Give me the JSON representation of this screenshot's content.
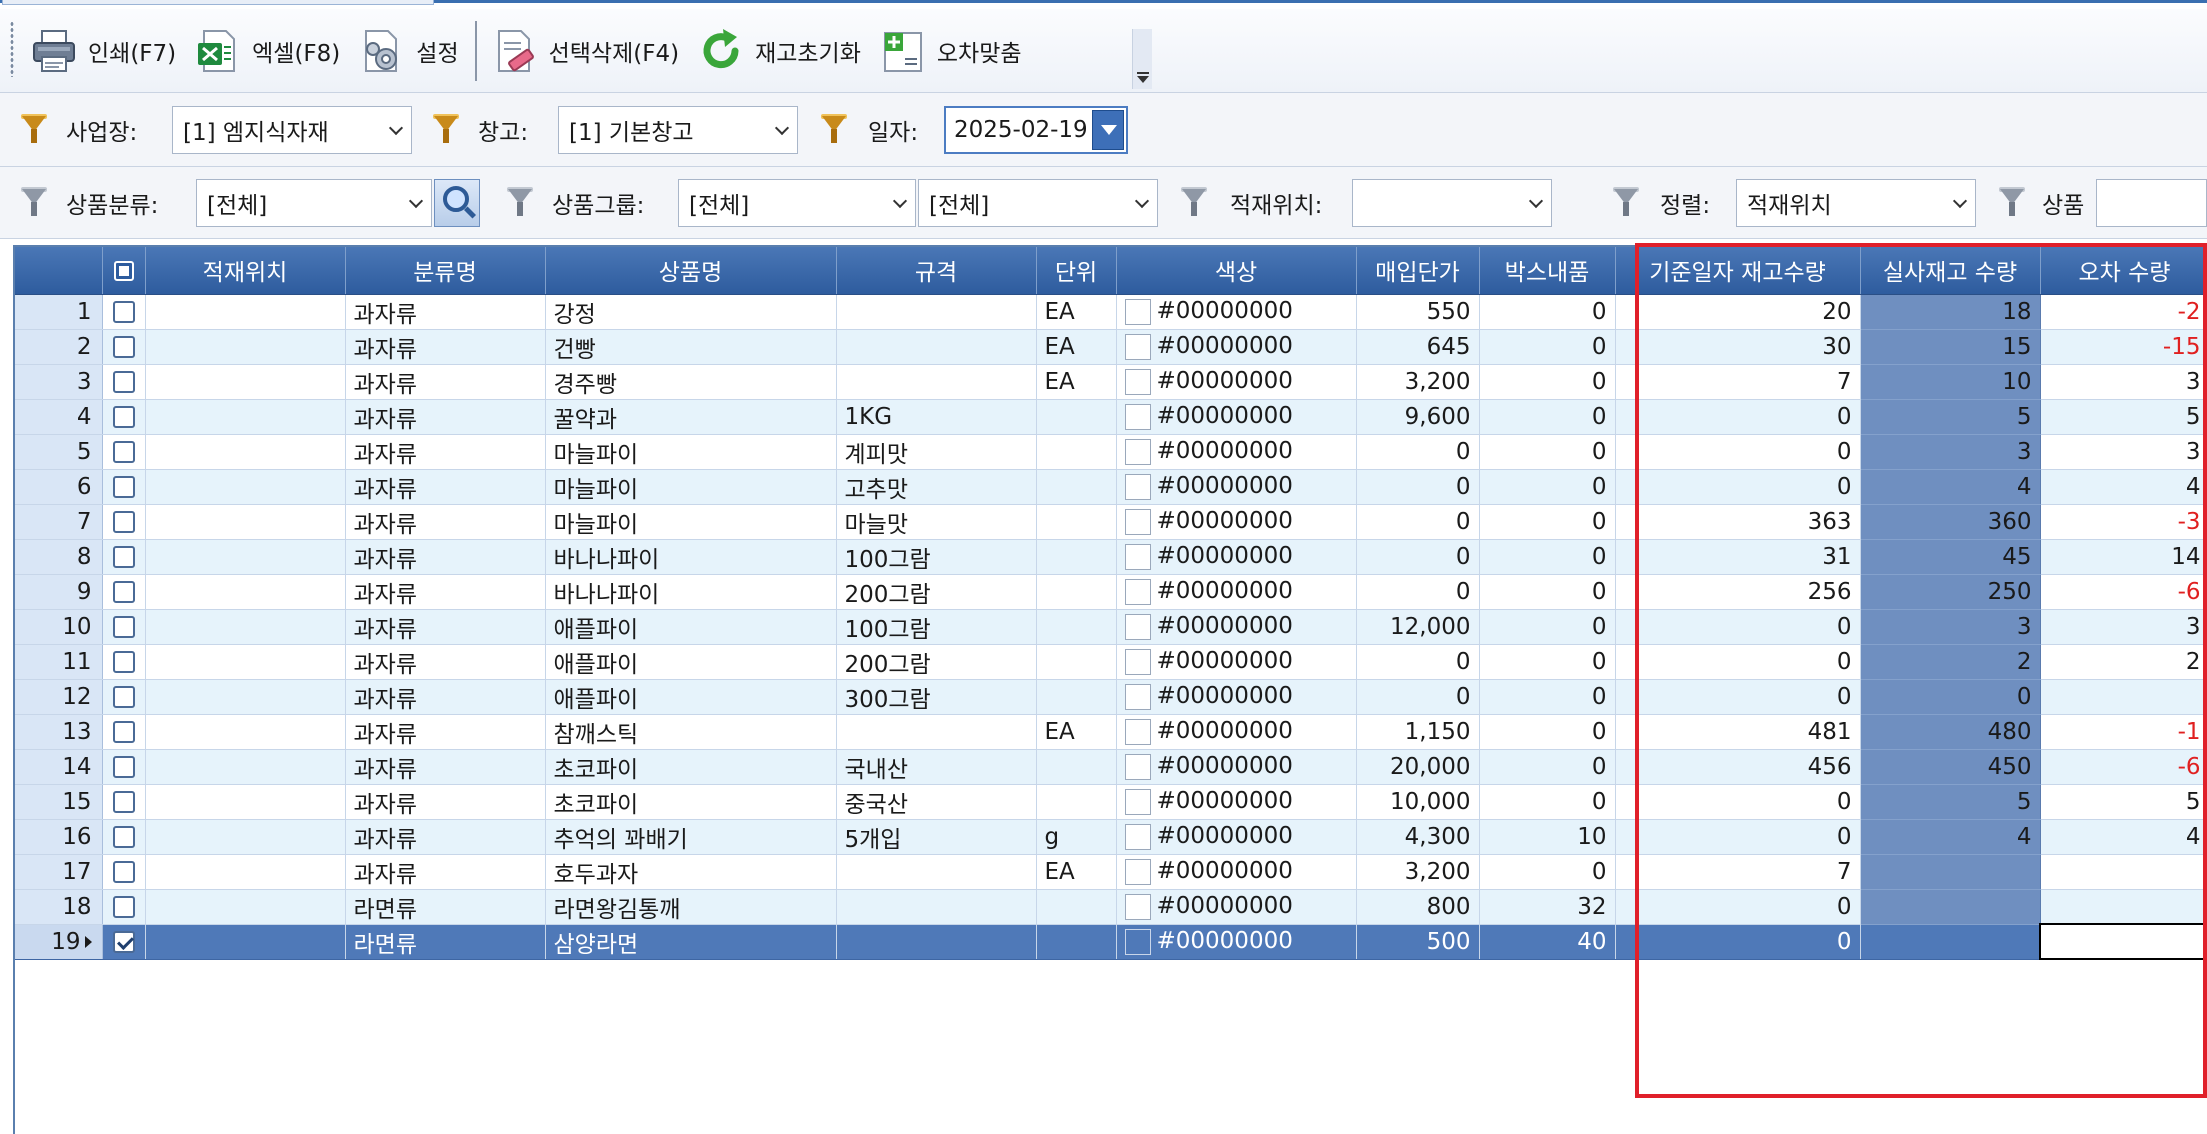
{
  "toolbar": {
    "buttons": [
      {
        "icon": "printer-icon",
        "label": "인쇄(F7)"
      },
      {
        "icon": "excel-icon",
        "label": "엑셀(F8)"
      },
      {
        "icon": "settings-icon",
        "label": "설정"
      },
      {
        "icon": "delete-selected-icon",
        "label": "선택삭제(F4)"
      },
      {
        "icon": "refresh-icon",
        "label": "재고초기화"
      },
      {
        "icon": "adjust-icon",
        "label": "오차맞춤"
      }
    ]
  },
  "filters": {
    "business_label": "사업장:",
    "business_value": "[1] 엠지식자재",
    "warehouse_label": "창고:",
    "warehouse_value": "[1] 기본창고",
    "date_label": "일자:",
    "date_value": "2025-02-19",
    "category_label": "상품분류:",
    "category_value": "[전체]",
    "group_label": "상품그룹:",
    "group_value1": "[전체]",
    "group_value2": "[전체]",
    "location_label": "적재위치:",
    "location_value": "",
    "sort_label": "정렬:",
    "sort_value": "적재위치",
    "product_label": "상품",
    "product_value": ""
  },
  "grid": {
    "columns": [
      "",
      "",
      "적재위치",
      "분류명",
      "상품명",
      "규격",
      "단위",
      "색상",
      "매입단가",
      "박스내품",
      "기준일자 재고수량",
      "실사재고 수량",
      "오차 수량"
    ],
    "rows": [
      {
        "no": "1",
        "checked": false,
        "location": "",
        "category": "과자류",
        "name": "강정",
        "spec": "",
        "unit": "EA",
        "color": "#00000000",
        "price": "550",
        "box": "0",
        "base_qty": "20",
        "actual_qty": "18",
        "diff": "-2"
      },
      {
        "no": "2",
        "checked": false,
        "location": "",
        "category": "과자류",
        "name": "건빵",
        "spec": "",
        "unit": "EA",
        "color": "#00000000",
        "price": "645",
        "box": "0",
        "base_qty": "30",
        "actual_qty": "15",
        "diff": "-15"
      },
      {
        "no": "3",
        "checked": false,
        "location": "",
        "category": "과자류",
        "name": "경주빵",
        "spec": "",
        "unit": "EA",
        "color": "#00000000",
        "price": "3,200",
        "box": "0",
        "base_qty": "7",
        "actual_qty": "10",
        "diff": "3"
      },
      {
        "no": "4",
        "checked": false,
        "location": "",
        "category": "과자류",
        "name": "꿀약과",
        "spec": "1KG",
        "unit": "",
        "color": "#00000000",
        "price": "9,600",
        "box": "0",
        "base_qty": "0",
        "actual_qty": "5",
        "diff": "5"
      },
      {
        "no": "5",
        "checked": false,
        "location": "",
        "category": "과자류",
        "name": "마늘파이",
        "spec": "계피맛",
        "unit": "",
        "color": "#00000000",
        "price": "0",
        "box": "0",
        "base_qty": "0",
        "actual_qty": "3",
        "diff": "3"
      },
      {
        "no": "6",
        "checked": false,
        "location": "",
        "category": "과자류",
        "name": "마늘파이",
        "spec": "고추맛",
        "unit": "",
        "color": "#00000000",
        "price": "0",
        "box": "0",
        "base_qty": "0",
        "actual_qty": "4",
        "diff": "4"
      },
      {
        "no": "7",
        "checked": false,
        "location": "",
        "category": "과자류",
        "name": "마늘파이",
        "spec": "마늘맛",
        "unit": "",
        "color": "#00000000",
        "price": "0",
        "box": "0",
        "base_qty": "363",
        "actual_qty": "360",
        "diff": "-3"
      },
      {
        "no": "8",
        "checked": false,
        "location": "",
        "category": "과자류",
        "name": "바나나파이",
        "spec": "100그람",
        "unit": "",
        "color": "#00000000",
        "price": "0",
        "box": "0",
        "base_qty": "31",
        "actual_qty": "45",
        "diff": "14"
      },
      {
        "no": "9",
        "checked": false,
        "location": "",
        "category": "과자류",
        "name": "바나나파이",
        "spec": "200그람",
        "unit": "",
        "color": "#00000000",
        "price": "0",
        "box": "0",
        "base_qty": "256",
        "actual_qty": "250",
        "diff": "-6"
      },
      {
        "no": "10",
        "checked": false,
        "location": "",
        "category": "과자류",
        "name": "애플파이",
        "spec": "100그람",
        "unit": "",
        "color": "#00000000",
        "price": "12,000",
        "box": "0",
        "base_qty": "0",
        "actual_qty": "3",
        "diff": "3"
      },
      {
        "no": "11",
        "checked": false,
        "location": "",
        "category": "과자류",
        "name": "애플파이",
        "spec": "200그람",
        "unit": "",
        "color": "#00000000",
        "price": "0",
        "box": "0",
        "base_qty": "0",
        "actual_qty": "2",
        "diff": "2"
      },
      {
        "no": "12",
        "checked": false,
        "location": "",
        "category": "과자류",
        "name": "애플파이",
        "spec": "300그람",
        "unit": "",
        "color": "#00000000",
        "price": "0",
        "box": "0",
        "base_qty": "0",
        "actual_qty": "0",
        "diff": ""
      },
      {
        "no": "13",
        "checked": false,
        "location": "",
        "category": "과자류",
        "name": "참깨스틱",
        "spec": "",
        "unit": "EA",
        "color": "#00000000",
        "price": "1,150",
        "box": "0",
        "base_qty": "481",
        "actual_qty": "480",
        "diff": "-1"
      },
      {
        "no": "14",
        "checked": false,
        "location": "",
        "category": "과자류",
        "name": "초코파이",
        "spec": "국내산",
        "unit": "",
        "color": "#00000000",
        "price": "20,000",
        "box": "0",
        "base_qty": "456",
        "actual_qty": "450",
        "diff": "-6"
      },
      {
        "no": "15",
        "checked": false,
        "location": "",
        "category": "과자류",
        "name": "초코파이",
        "spec": "중국산",
        "unit": "",
        "color": "#00000000",
        "price": "10,000",
        "box": "0",
        "base_qty": "0",
        "actual_qty": "5",
        "diff": "5"
      },
      {
        "no": "16",
        "checked": false,
        "location": "",
        "category": "과자류",
        "name": "추억의 꽈배기",
        "spec": "5개입",
        "unit": "g",
        "color": "#00000000",
        "price": "4,300",
        "box": "10",
        "base_qty": "0",
        "actual_qty": "4",
        "diff": "4"
      },
      {
        "no": "17",
        "checked": false,
        "location": "",
        "category": "과자류",
        "name": "호두과자",
        "spec": "",
        "unit": "EA",
        "color": "#00000000",
        "price": "3,200",
        "box": "0",
        "base_qty": "7",
        "actual_qty": "",
        "diff": ""
      },
      {
        "no": "18",
        "checked": false,
        "location": "",
        "category": "라면류",
        "name": "라면왕김통깨",
        "spec": "",
        "unit": "",
        "color": "#00000000",
        "price": "800",
        "box": "32",
        "base_qty": "0",
        "actual_qty": "",
        "diff": ""
      },
      {
        "no": "19",
        "checked": true,
        "selected": true,
        "location": "",
        "category": "라면류",
        "name": "삼양라면",
        "spec": "",
        "unit": "",
        "color": "#00000000",
        "price": "500",
        "box": "40",
        "base_qty": "0",
        "actual_qty": "",
        "diff": ""
      }
    ]
  },
  "colors": {
    "header": "#2e5c9e",
    "actual_column": "#6f8fc0",
    "negative": "#e02020",
    "highlight_box": "#e0202a",
    "alt_row": "#e6f3fb"
  }
}
